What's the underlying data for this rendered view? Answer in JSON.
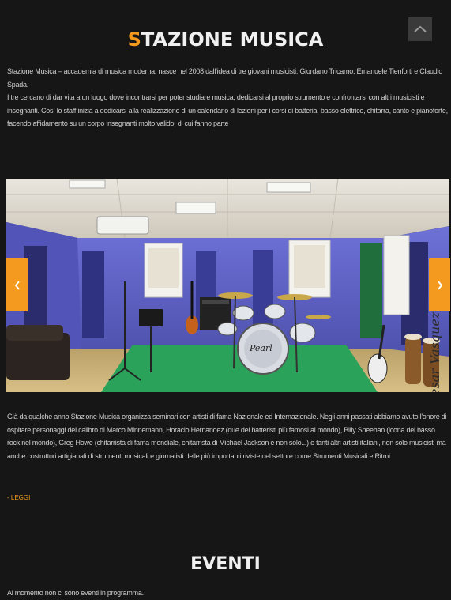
{
  "page": {
    "title_first_letter": "S",
    "title_rest": "TAZIONE MUSICA",
    "intro_line1": "Stazione Musica – accademia di musica moderna, nasce nel 2008 dall'idea di tre giovani musicisti: Giordano Tricamo, Emanuele Tienforti e Claudio Spada.",
    "intro_line2": "I tre cercano di dar vita a un luogo dove incontrarsi per poter studiare musica, dedicarsi al proprio strumento e confrontarsi con altri musicisti e insegnanti. Così lo staff inizia a dedicarsi alla realizzazione di un calendario di lezioni per i corsi di batteria, basso elettrico, chitarra, canto e pianoforte, facendo affidamento su un corpo insegnanti molto valido, di cui fanno parte",
    "seminar_text": "Già da qualche anno Stazione Musica organizza seminari con artisti di fama Nazionale ed Internazionale. Negli anni passati abbiamo avuto l'onore di ospitare personaggi del calibro di Marco Minnemann, Horacio Hernandez (due dei batteristi più famosi al mondo), Billy Sheehan (icona del basso rock nel mondo), Greg Howe (chitarrista di fama mondiale, chitarrista di Michael Jackson e non solo...) e tanti altri artisti italiani, non solo musicisti ma anche costruttori artigianali di strumenti musicali e giornalisti delle più importanti riviste del settore come Strumenti Musicali e Ritmi.",
    "read_more": "- LEGGI",
    "events_title": "EVENTI",
    "events_text": "Al momento non ci sono eventi in programma.",
    "photo_signature": "esar Vasquez",
    "drum_brand": "Pearl"
  },
  "colors": {
    "accent": "#f39a1f",
    "background": "#161616",
    "text": "#cfcfcf"
  },
  "icons": {
    "scroll_top": "chevron-up-icon",
    "prev": "chevron-left-icon",
    "next": "chevron-right-icon"
  }
}
